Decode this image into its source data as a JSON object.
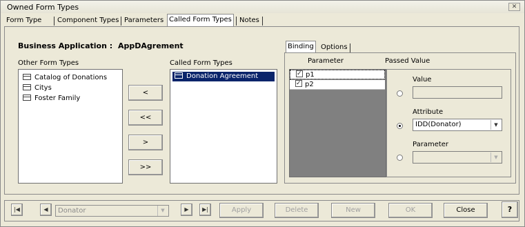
{
  "window": {
    "title": "Owned Form Types",
    "close_glyph": "✕"
  },
  "tabs": [
    "Form Type",
    "Component Types",
    "Parameters",
    "Called Form Types",
    "Notes"
  ],
  "business_application": {
    "label": "Business Application :",
    "value": "AppDAgrement"
  },
  "other_form_types": {
    "label": "Other Form Types",
    "items": [
      "Catalog of Donations",
      "Citys",
      "Foster Family"
    ]
  },
  "called_form_types": {
    "label": "Called Form Types",
    "items": [
      "Donation Agreement"
    ]
  },
  "move_buttons": [
    "<",
    "<<",
    ">",
    ">>"
  ],
  "right_tabs": [
    "Binding",
    "Options"
  ],
  "binding": {
    "parameter_header": "Parameter",
    "passed_value_header": "Passed Value",
    "parameters": [
      "p1",
      "p2"
    ],
    "value_label": "Value",
    "value_text": "",
    "attribute_label": "Attribute",
    "attribute_value": "IDD(Donator)",
    "parameter_label": "Parameter",
    "parameter_value": "",
    "selected_option": "Attribute"
  },
  "navigator": {
    "first": "|◀",
    "prev": "◀",
    "next": "▶",
    "last": "▶|",
    "combo_value": "Donator",
    "combo_arrow": "▼"
  },
  "actions": {
    "apply": "Apply",
    "delete": "Delete",
    "new": "New",
    "ok": "OK",
    "close": "Close",
    "help": "?"
  },
  "colors": {
    "selection": "#0a246a",
    "face": "#ece9d8",
    "disabled_text": "#a0a0a0"
  }
}
